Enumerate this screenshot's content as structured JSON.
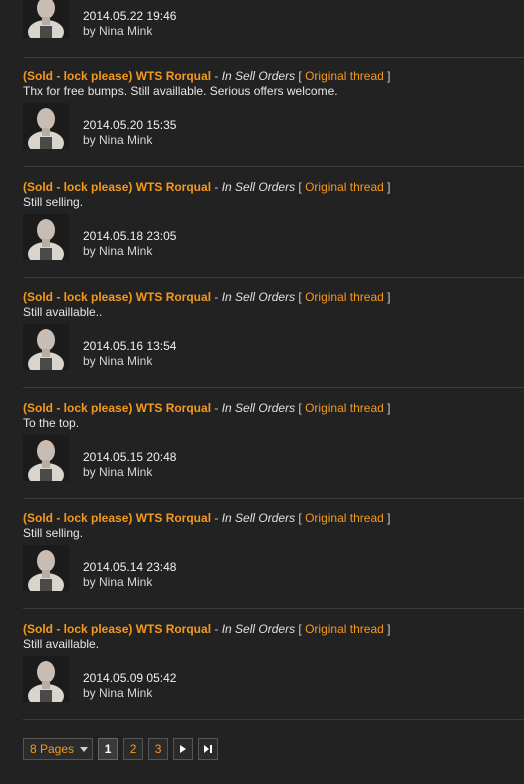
{
  "top_post": {
    "date": "2014.05.22 19:46",
    "by": "by Nina Mink"
  },
  "posts": [
    {
      "title": "(Sold - lock please) WTS Rorqual",
      "sep": " - ",
      "forum": "In Sell Orders",
      "bracket_open": " [ ",
      "orig": "Original thread",
      "bracket_close": " ]",
      "body": "Thx for free bumps. Still availlable. Serious offers welcome.",
      "date": "2014.05.20 15:35",
      "by": "by Nina Mink"
    },
    {
      "title": "(Sold - lock please) WTS Rorqual",
      "sep": " - ",
      "forum": "In Sell Orders",
      "bracket_open": " [ ",
      "orig": "Original thread",
      "bracket_close": " ]",
      "body": "Still selling.",
      "date": "2014.05.18 23:05",
      "by": "by Nina Mink"
    },
    {
      "title": "(Sold - lock please) WTS Rorqual",
      "sep": " - ",
      "forum": "In Sell Orders",
      "bracket_open": " [ ",
      "orig": "Original thread",
      "bracket_close": " ]",
      "body": "Still availlable..",
      "date": "2014.05.16 13:54",
      "by": "by Nina Mink"
    },
    {
      "title": "(Sold - lock please) WTS Rorqual",
      "sep": " - ",
      "forum": "In Sell Orders",
      "bracket_open": " [ ",
      "orig": "Original thread",
      "bracket_close": " ]",
      "body": "To the top.",
      "date": "2014.05.15 20:48",
      "by": "by Nina Mink"
    },
    {
      "title": "(Sold - lock please) WTS Rorqual",
      "sep": " - ",
      "forum": "In Sell Orders",
      "bracket_open": " [ ",
      "orig": "Original thread",
      "bracket_close": " ]",
      "body": "Still selling.",
      "date": "2014.05.14 23:48",
      "by": "by Nina Mink"
    },
    {
      "title": "(Sold - lock please) WTS Rorqual",
      "sep": " - ",
      "forum": "In Sell Orders",
      "bracket_open": " [ ",
      "orig": "Original thread",
      "bracket_close": " ]",
      "body": "Still availlable.",
      "date": "2014.05.09 05:42",
      "by": "by Nina Mink"
    }
  ],
  "pager": {
    "pages_label": "8 Pages",
    "pages": [
      "1",
      "2",
      "3"
    ],
    "current_page": "1"
  },
  "colors": {
    "background": "#222222",
    "accent": "#f39a1d",
    "divider": "#3b3b3b"
  },
  "icons": {
    "avatar": "avatar-portrait",
    "next": "next-page-icon",
    "last": "last-page-icon",
    "dropdown": "chevron-down-icon"
  }
}
